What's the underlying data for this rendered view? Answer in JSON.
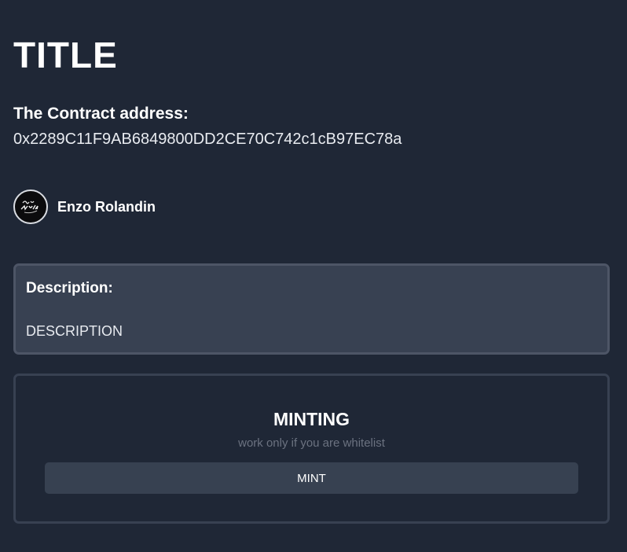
{
  "header": {
    "title": "TITLE"
  },
  "contract": {
    "label": "The Contract address:",
    "address": "0x2289C11F9AB6849800DD2CE70C742c1cB97EC78a"
  },
  "author": {
    "name": "Enzo Rolandin",
    "avatar_icon": "avatar-logo-icon"
  },
  "description": {
    "label": "Description:",
    "text": "DESCRIPTION"
  },
  "minting": {
    "heading": "MINTING",
    "subtitle": "work only if you are whitelist",
    "button_label": "MINT"
  },
  "colors": {
    "background": "#1f2736",
    "card": "#384152",
    "button": "#374151",
    "muted_text": "#6b7280"
  }
}
